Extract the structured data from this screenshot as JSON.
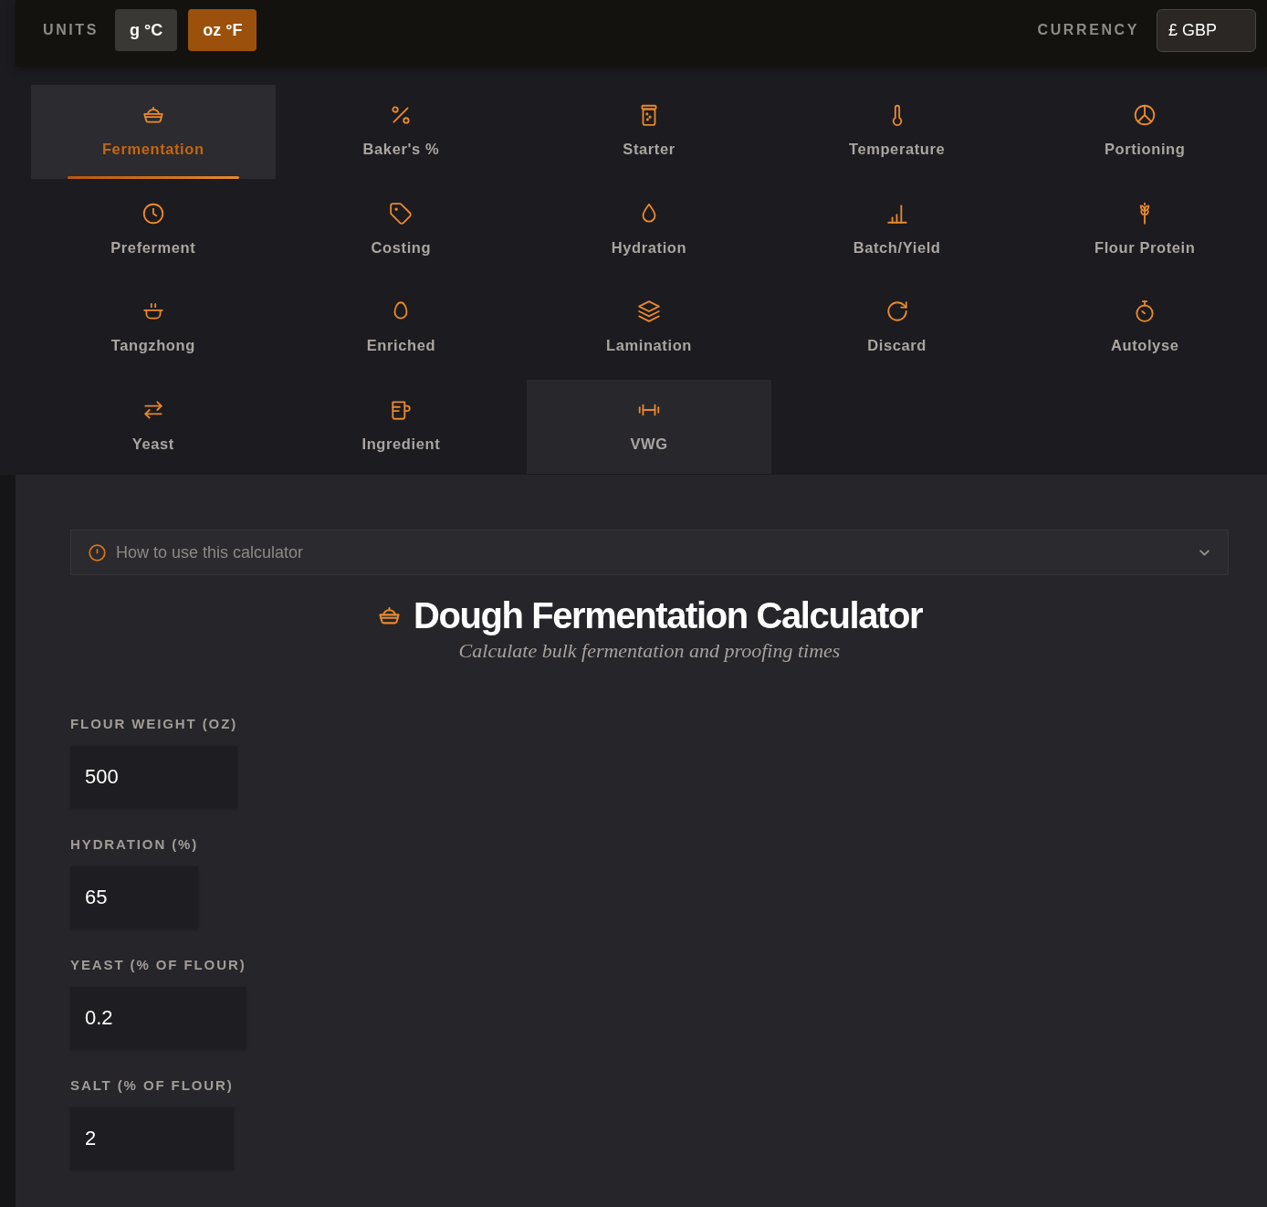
{
  "units": {
    "label": "UNITS",
    "options": [
      {
        "label": "g °C",
        "selected": false
      },
      {
        "label": "oz °F",
        "selected": true
      }
    ]
  },
  "currency": {
    "label": "CURRENCY",
    "value": "£ GBP"
  },
  "tabs": [
    {
      "label": "Fermentation",
      "selected": true,
      "hovered": false
    },
    {
      "label": "Baker's %",
      "selected": false,
      "hovered": false
    },
    {
      "label": "Starter",
      "selected": false,
      "hovered": false
    },
    {
      "label": "Temperature",
      "selected": false,
      "hovered": false
    },
    {
      "label": "Portioning",
      "selected": false,
      "hovered": false
    },
    {
      "label": "Preferment",
      "selected": false,
      "hovered": false
    },
    {
      "label": "Costing",
      "selected": false,
      "hovered": false
    },
    {
      "label": "Hydration",
      "selected": false,
      "hovered": false
    },
    {
      "label": "Batch/Yield",
      "selected": false,
      "hovered": false
    },
    {
      "label": "Flour Protein",
      "selected": false,
      "hovered": false
    },
    {
      "label": "Tangzhong",
      "selected": false,
      "hovered": false
    },
    {
      "label": "Enriched",
      "selected": false,
      "hovered": false
    },
    {
      "label": "Lamination",
      "selected": false,
      "hovered": false
    },
    {
      "label": "Discard",
      "selected": false,
      "hovered": false
    },
    {
      "label": "Autolyse",
      "selected": false,
      "hovered": false
    },
    {
      "label": "Yeast",
      "selected": false,
      "hovered": false
    },
    {
      "label": "Ingredient",
      "selected": false,
      "hovered": false
    },
    {
      "label": "VWG",
      "selected": false,
      "hovered": true
    }
  ],
  "help": {
    "label": "How to use this calculator",
    "expanded": false
  },
  "calculator": {
    "title": "Dough Fermentation Calculator",
    "subtitle": "Calculate bulk fermentation and proofing times"
  },
  "fields": [
    {
      "label": "FLOUR WEIGHT (OZ)",
      "value": "500"
    },
    {
      "label": "HYDRATION (%)",
      "value": "65"
    },
    {
      "label": "YEAST (% OF FLOUR)",
      "value": "0.2"
    },
    {
      "label": "SALT (% OF FLOUR)",
      "value": "2"
    }
  ]
}
